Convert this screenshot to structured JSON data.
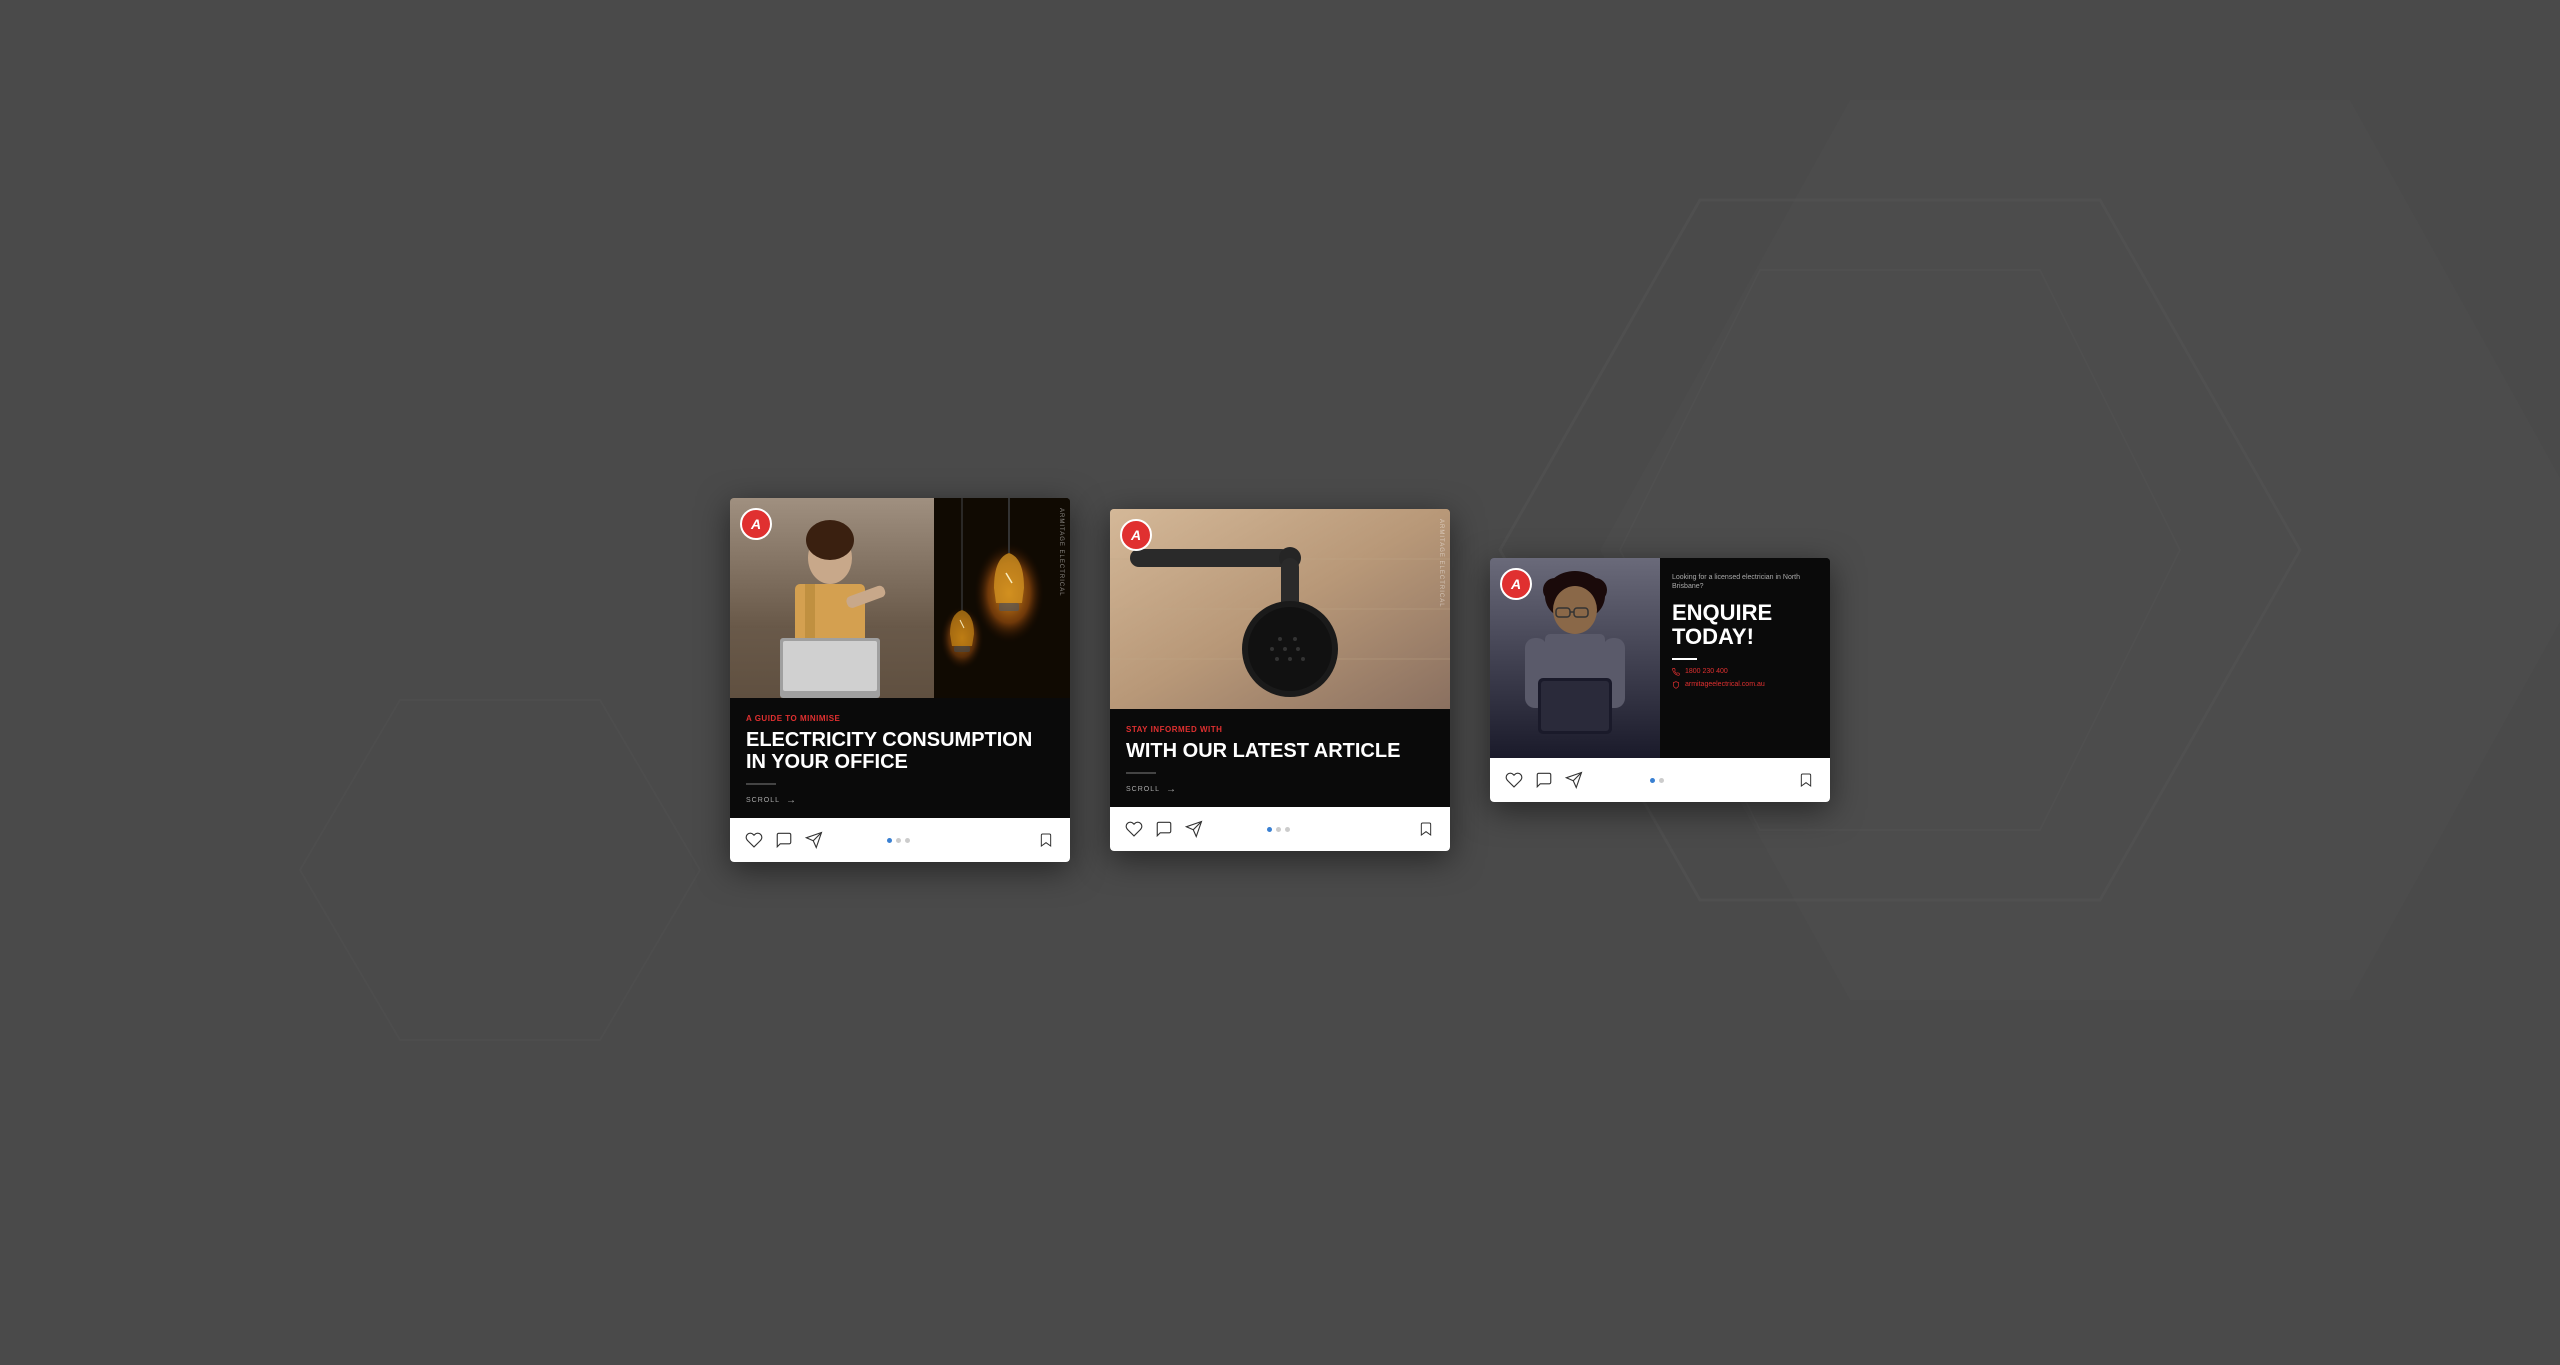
{
  "background": {
    "color": "#4a4a4a"
  },
  "brand": {
    "name": "Armitage Electrical",
    "logo_letter": "A",
    "logo_color": "#e03030",
    "vertical_text": "ARMITAGE ELECTRICAL"
  },
  "cards": [
    {
      "id": "card1",
      "subtitle": "A GUIDE TO MINIMISE",
      "title": "ELECTRICITY CONSUMPTION IN YOUR OFFICE",
      "scroll_label": "SCROLL",
      "dots": [
        true,
        false,
        false
      ],
      "actions": [
        "heart",
        "comment",
        "send"
      ],
      "image_type": "split"
    },
    {
      "id": "card2",
      "subtitle": "STAY INFORMED WITH",
      "title": "WITH OUR LATEST ARTICLE",
      "scroll_label": "SCROLL",
      "dots": [
        true,
        false,
        false
      ],
      "actions": [
        "heart",
        "comment",
        "send"
      ],
      "image_type": "shower"
    },
    {
      "id": "card3",
      "sub_text": "Looking for a licensed electrician in North Brisbane?",
      "title": "ENQUIRE TODAY!",
      "phone": "1800 230 400",
      "website": "armitageelectrical.com.au",
      "dots": [
        true,
        false
      ],
      "actions": [
        "heart",
        "comment",
        "send"
      ],
      "image_type": "person-tablet"
    }
  ]
}
